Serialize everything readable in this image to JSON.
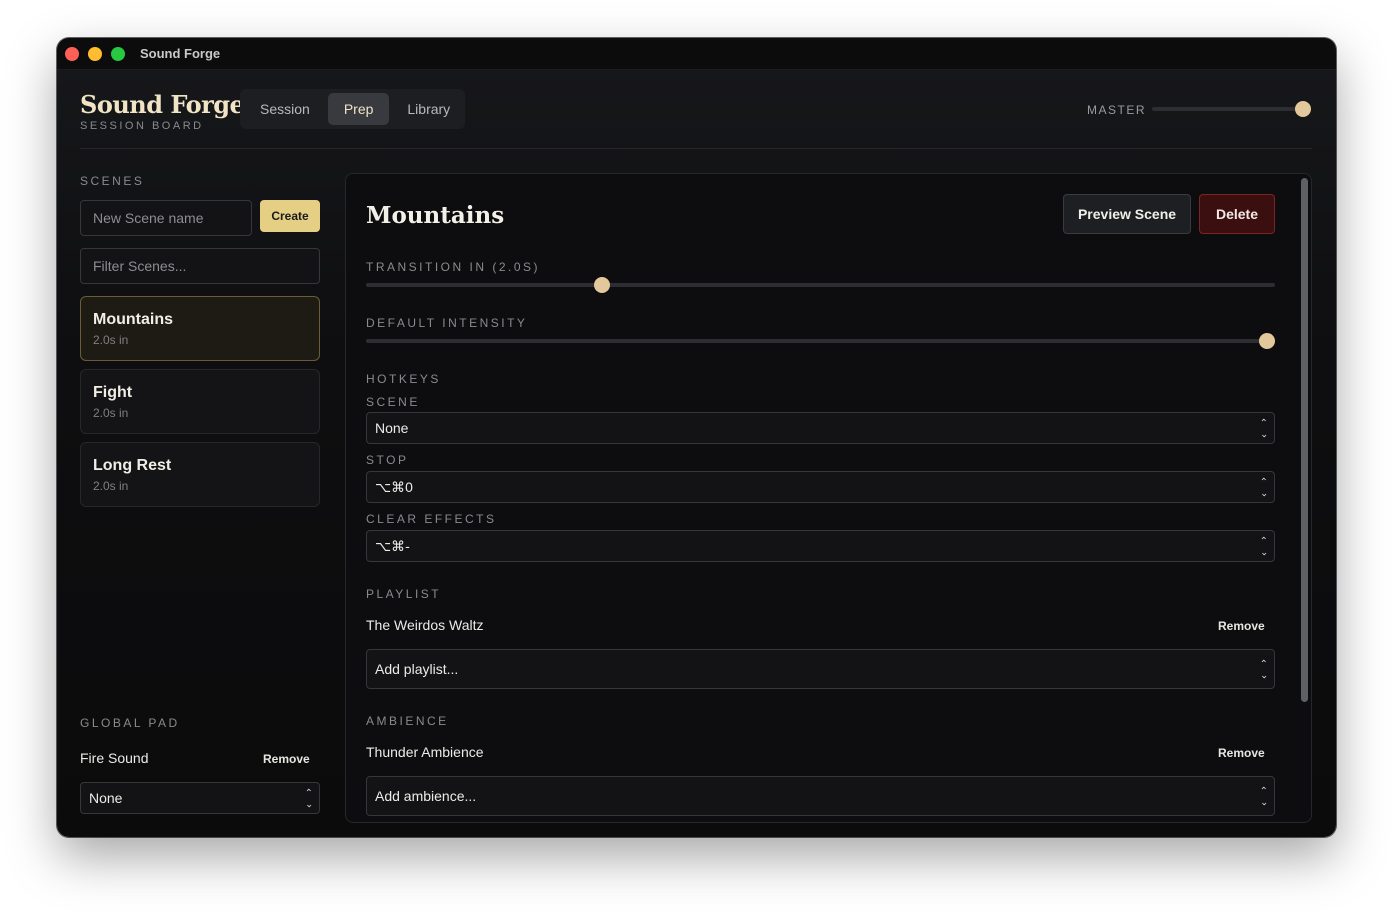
{
  "window": {
    "title": "Sound Forge"
  },
  "brand": {
    "title": "Sound Forge",
    "subtitle": "SESSION BOARD"
  },
  "tabs": [
    {
      "label": "Session",
      "active": false
    },
    {
      "label": "Prep",
      "active": true
    },
    {
      "label": "Library",
      "active": false
    }
  ],
  "master": {
    "label": "MASTER",
    "level": 1.0
  },
  "sidebar": {
    "scenes_label": "SCENES",
    "new_scene_placeholder": "New Scene name",
    "create_label": "Create",
    "filter_placeholder": "Filter Scenes...",
    "scenes": [
      {
        "name": "Mountains",
        "meta": "2.0s in",
        "active": true
      },
      {
        "name": "Fight",
        "meta": "2.0s in",
        "active": false
      },
      {
        "name": "Long Rest",
        "meta": "2.0s in",
        "active": false
      }
    ],
    "global_pad_label": "GLOBAL PAD",
    "global_item": "Fire Sound",
    "remove_label": "Remove",
    "global_select_value": "None"
  },
  "panel": {
    "title": "Mountains",
    "preview_label": "Preview Scene",
    "delete_label": "Delete",
    "transition_label": "TRANSITION IN (2.0S)",
    "transition_value": 0.255,
    "intensity_label": "DEFAULT INTENSITY",
    "intensity_value": 1.0,
    "hotkeys_label": "HOTKEYS",
    "scene_hotkey_label": "SCENE",
    "scene_hotkey_value": "None",
    "stop_label": "STOP",
    "stop_value": "⌥⌘0",
    "clear_effects_label": "CLEAR EFFECTS",
    "clear_effects_value": "⌥⌘-",
    "playlist_label": "PLAYLIST",
    "playlist_item": "The Weirdos Waltz",
    "remove_label": "Remove",
    "add_playlist": "Add playlist...",
    "ambience_label": "AMBIENCE",
    "ambience_item": "Thunder Ambience",
    "add_ambience": "Add ambience..."
  },
  "colors": {
    "accent": "#e5cf84",
    "thumb": "#e3c89c",
    "danger": "#3b0f10"
  }
}
